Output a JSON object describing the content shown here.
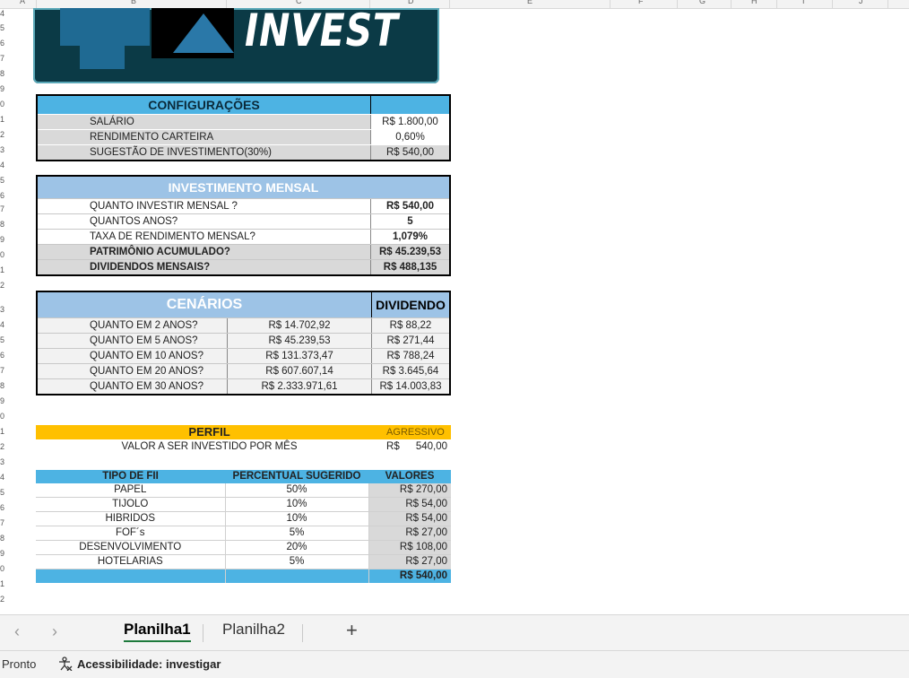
{
  "columns": [
    "A",
    "B",
    "C",
    "D",
    "E",
    "F",
    "G",
    "H",
    "I",
    "J"
  ],
  "rows": [
    "4",
    "5",
    "6",
    "7",
    "8",
    "9",
    "0",
    "1",
    "2",
    "3",
    "4",
    "5",
    "6",
    "7",
    "8",
    "9",
    "0",
    "1",
    "2",
    "3",
    "4",
    "5",
    "6",
    "7",
    "8",
    "9",
    "0",
    "1",
    "2",
    "3",
    "4",
    "5",
    "6",
    "7",
    "8",
    "9",
    "0",
    "1",
    "2",
    "3",
    "4",
    "5",
    "6",
    "7",
    "8",
    "9",
    "0",
    "1",
    "2"
  ],
  "logo": {
    "text": "INVEST"
  },
  "config": {
    "title": "CONFIGURAÇÕES",
    "rows": [
      {
        "label": "SALÁRIO",
        "value": "R$ 1.800,00"
      },
      {
        "label": "RENDIMENTO CARTEIRA",
        "value": "0,60%"
      },
      {
        "label": "SUGESTÃO DE INVESTIMENTO(30%)",
        "value": "R$ 540,00"
      }
    ]
  },
  "investimento": {
    "title": "INVESTIMENTO MENSAL",
    "rows": [
      {
        "label": "QUANTO INVESTIR MENSAL ?",
        "value": "R$ 540,00"
      },
      {
        "label": "QUANTOS ANOS?",
        "value": "5"
      },
      {
        "label": "TAXA DE RENDIMENTO MENSAL?",
        "value": "1,079%"
      },
      {
        "label": "PATRIMÔNIO ACUMULADO?",
        "value": "R$ 45.239,53"
      },
      {
        "label": "DIVIDENDOS MENSAIS?",
        "value": "R$ 488,135"
      }
    ]
  },
  "cenarios": {
    "title": "CENÁRIOS",
    "dividend_header": "DIVIDENDO",
    "rows": [
      {
        "label": "QUANTO EM 2 ANOS?",
        "total": "R$ 14.702,92",
        "dividend": "R$ 88,22"
      },
      {
        "label": "QUANTO EM 5 ANOS?",
        "total": "R$ 45.239,53",
        "dividend": "R$ 271,44"
      },
      {
        "label": "QUANTO EM 10 ANOS?",
        "total": "R$ 131.373,47",
        "dividend": "R$ 788,24"
      },
      {
        "label": "QUANTO EM 20 ANOS?",
        "total": "R$ 607.607,14",
        "dividend": "R$ 3.645,64"
      },
      {
        "label": "QUANTO EM 30 ANOS?",
        "total": "R$ 2.333.971,61",
        "dividend": "R$ 14.003,83"
      }
    ]
  },
  "perfil": {
    "title": "PERFIL",
    "value": "AGRESSIVO",
    "label": "VALOR A SER INVESTIDO POR MÊS",
    "currency": "R$",
    "amount": "540,00"
  },
  "fii": {
    "headers": [
      "TIPO DE FII",
      "PERCENTUAL SUGERIDO",
      "VALORES"
    ],
    "rows": [
      {
        "tipo": "PAPEL",
        "pct": "50%",
        "valor": "R$ 270,00"
      },
      {
        "tipo": "TIJOLO",
        "pct": "10%",
        "valor": "R$ 54,00"
      },
      {
        "tipo": "HIBRIDOS",
        "pct": "10%",
        "valor": "R$ 54,00"
      },
      {
        "tipo": "FOF´s",
        "pct": "5%",
        "valor": "R$ 27,00"
      },
      {
        "tipo": "DESENVOLVIMENTO",
        "pct": "20%",
        "valor": "R$ 108,00"
      },
      {
        "tipo": "HOTELARIAS",
        "pct": "5%",
        "valor": "R$ 27,00"
      }
    ],
    "total": "R$ 540,00"
  },
  "tabs": {
    "sheet1": "Planilha1",
    "sheet2": "Planilha2",
    "add": "+",
    "prev": "‹",
    "next": "›"
  },
  "status": {
    "ready": "Pronto",
    "accessibility": "Acessibilidade: investigar"
  },
  "colors": {
    "header_blue": "#4db3e3",
    "light_blue": "#9dc3e6",
    "gray": "#d9d9d9",
    "yellow": "#ffc000",
    "logo_bg": "#0b3a46"
  }
}
